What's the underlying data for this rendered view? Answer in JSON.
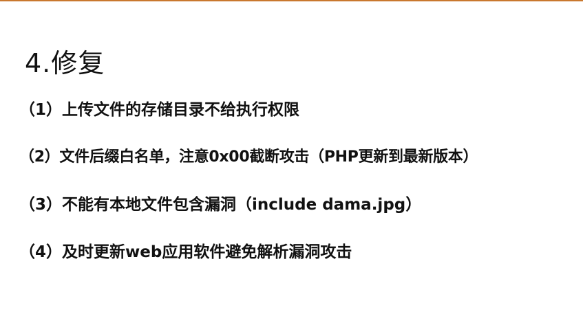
{
  "accent_color": "#c9782e",
  "slide": {
    "title": "4.修复",
    "items": [
      {
        "text": "（1）上传文件的存储目录不给执行权限"
      },
      {
        "text": "（2）文件后缀白名单，注意0x00截断攻击（PHP更新到最新版本）"
      },
      {
        "text": "（3）不能有本地文件包含漏洞（include dama.jpg）"
      },
      {
        "text": "（4）及时更新web应用软件避免解析漏洞攻击"
      }
    ]
  }
}
